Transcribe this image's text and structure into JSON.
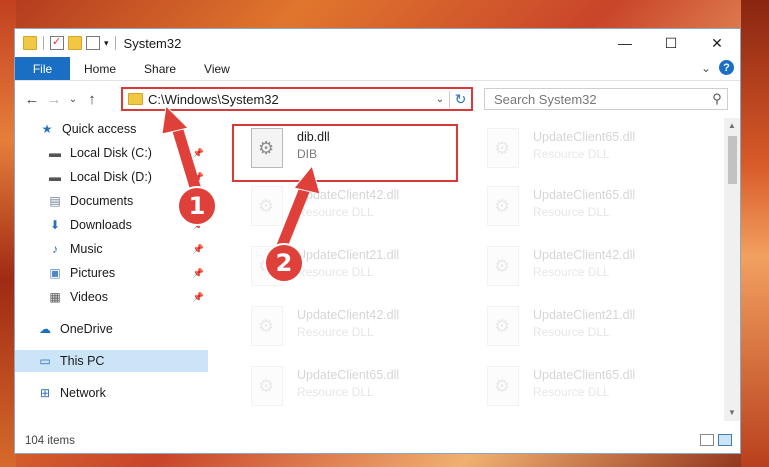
{
  "window": {
    "title": "System32",
    "controls": {
      "minimize": "—",
      "maximize": "☐",
      "close": "✕"
    }
  },
  "ribbon": {
    "tabs": [
      "File",
      "Home",
      "Share",
      "View"
    ],
    "expand": "⌄",
    "help": "?"
  },
  "address": {
    "path": "C:\\Windows\\System32",
    "dropdown": "⌄",
    "refresh": "↻"
  },
  "search": {
    "placeholder": "Search System32"
  },
  "navigation": {
    "back": "←",
    "forward": "→",
    "recent": "⌄",
    "up": "↑"
  },
  "sidebar": {
    "items": [
      {
        "label": "Quick access",
        "icon": "star-icon",
        "glyph": "★",
        "color": "#2a6fbc",
        "pinned": false
      },
      {
        "label": "Local Disk (C:)",
        "icon": "drive-icon",
        "glyph": "▬",
        "color": "#555555",
        "pinned": true
      },
      {
        "label": "Local Disk (D:)",
        "icon": "drive-icon",
        "glyph": "▬",
        "color": "#555555",
        "pinned": true
      },
      {
        "label": "Documents",
        "icon": "documents-icon",
        "glyph": "▤",
        "color": "#6a7d95",
        "pinned": true
      },
      {
        "label": "Downloads",
        "icon": "download-icon",
        "glyph": "⬇",
        "color": "#2a6fbc",
        "pinned": true
      },
      {
        "label": "Music",
        "icon": "music-icon",
        "glyph": "♪",
        "color": "#2a6fbc",
        "pinned": true
      },
      {
        "label": "Pictures",
        "icon": "pictures-icon",
        "glyph": "▣",
        "color": "#4f86c6",
        "pinned": true
      },
      {
        "label": "Videos",
        "icon": "video-icon",
        "glyph": "▦",
        "color": "#555555",
        "pinned": true
      },
      {
        "label": "OneDrive",
        "icon": "cloud-icon",
        "glyph": "☁",
        "color": "#1a6fc4",
        "pinned": false
      },
      {
        "label": "This PC",
        "icon": "computer-icon",
        "glyph": "▭",
        "color": "#2a6fbc",
        "pinned": false
      },
      {
        "label": "Network",
        "icon": "network-icon",
        "glyph": "⊞",
        "color": "#2a6fbc",
        "pinned": false
      }
    ]
  },
  "files": {
    "selected": {
      "name": "dib.dll",
      "description": "DIB"
    },
    "ghosts": [
      {
        "name": "UpdateClient65.dll",
        "description": "Resource DLL"
      },
      {
        "name": "UpdateClient42.dll",
        "description": "Resource DLL"
      },
      {
        "name": "UpdateClient65.dll",
        "description": "Resource DLL"
      },
      {
        "name": "UpdateClient21.dll",
        "description": "Resource DLL"
      },
      {
        "name": "UpdateClient42.dll",
        "description": "Resource DLL"
      },
      {
        "name": "UpdateClient42.dll",
        "description": "Resource DLL"
      },
      {
        "name": "UpdateClient21.dll",
        "description": "Resource DLL"
      },
      {
        "name": "UpdateClient65.dll",
        "description": "Resource DLL"
      },
      {
        "name": "UpdateClient65.dll",
        "description": "Resource DLL"
      }
    ]
  },
  "status": {
    "item_count": "104 items"
  },
  "annotations": {
    "step1": "1",
    "step2": "2"
  },
  "colors": {
    "accent": "#1a6fc4",
    "highlight": "#d93a37",
    "badge": "#e0403a"
  }
}
